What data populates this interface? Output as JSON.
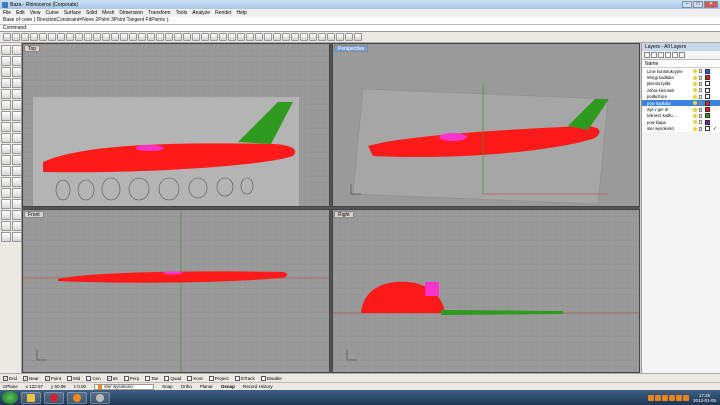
{
  "window": {
    "title": "Baza - Rhinoceros (Corporate)",
    "min": "–",
    "max": "□",
    "close": "✕"
  },
  "menu": [
    "File",
    "Edit",
    "View",
    "Curve",
    "Surface",
    "Solid",
    "Mesh",
    "Dimension",
    "Transform",
    "Tools",
    "Analyze",
    "Render",
    "Help"
  ],
  "command": {
    "history": "Base of cone ( DirectionConstraint=None  2Point  3Point  Tangent  FitPoints ):",
    "prompt": "Command:"
  },
  "viewports": {
    "top": "Top",
    "perspective": "Perspective",
    "front": "Front",
    "right": "Right"
  },
  "colors": {
    "fuselage": "#ff1a1a",
    "tail": "#2e9a1e",
    "canopy": "#ff33cc",
    "grid": "#8c8c8c"
  },
  "layers": {
    "panel_title": "Layers - All Layers",
    "column": "Name",
    "items": [
      {
        "name": "Linie konstrukcyjne",
        "color": "#3355ff"
      },
      {
        "name": "Wręgi kadłuba",
        "color": "#ff1a1a"
      },
      {
        "name": "płat skrzydła",
        "color": "#ffffff"
      },
      {
        "name": "żebra kierunek",
        "color": "#ffffff"
      },
      {
        "name": "podłużnice",
        "color": "#ffffff"
      },
      {
        "name": "pow kadłuba",
        "color": "#ff1a1a",
        "current": true
      },
      {
        "name": "wyt v ger dr",
        "color": "#ff1a1a"
      },
      {
        "name": "kołnierz kadłu...",
        "color": "#2e9a1e"
      },
      {
        "name": "pow klapa",
        "color": "#7a1fa2"
      },
      {
        "name": "ster wysokości",
        "color": "#ffffff",
        "check": "✓"
      }
    ]
  },
  "osnaps": [
    {
      "label": "End",
      "checked": true
    },
    {
      "label": "Near",
      "checked": true
    },
    {
      "label": "Point",
      "checked": true
    },
    {
      "label": "Mid",
      "checked": false
    },
    {
      "label": "Cen",
      "checked": false
    },
    {
      "label": "Int",
      "checked": true
    },
    {
      "label": "Perp",
      "checked": false
    },
    {
      "label": "Tan",
      "checked": false
    },
    {
      "label": "Quad",
      "checked": false
    },
    {
      "label": "Knot",
      "checked": false
    },
    {
      "label": "Project",
      "checked": false
    },
    {
      "label": "STrack",
      "checked": false
    },
    {
      "label": "Disable",
      "checked": false
    }
  ],
  "status": {
    "cplane": "CPlane",
    "x": "x 122.97",
    "y": "y 50.06",
    "z": "z 0.00",
    "layer": "ster wysokości",
    "snap": "Snap",
    "ortho": "Ortho",
    "planar": "Planar",
    "osnap": "Osnap",
    "record": "Record History"
  },
  "clock": {
    "time": "17:25",
    "date": "2013-01-05"
  }
}
